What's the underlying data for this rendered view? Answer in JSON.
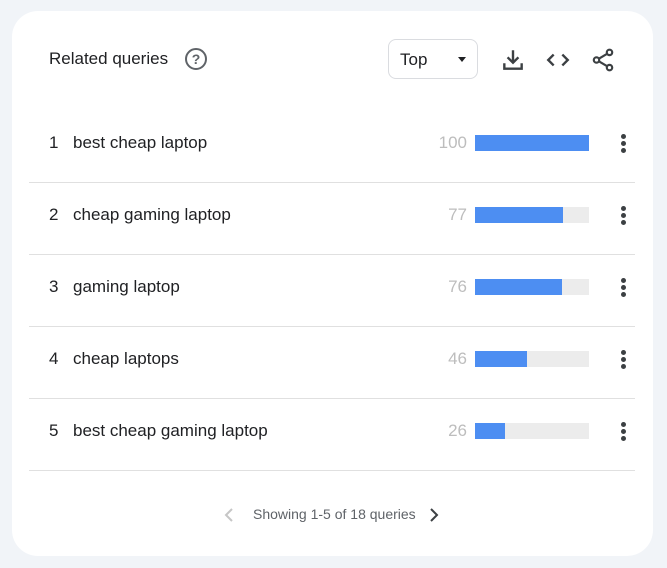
{
  "header": {
    "title": "Related queries",
    "help_icon": "?",
    "select": {
      "selected": "Top"
    },
    "icons": [
      "download-icon",
      "embed-code-icon",
      "share-icon"
    ]
  },
  "rows": [
    {
      "rank": "1",
      "query": "best cheap laptop",
      "value": "100",
      "fill": 100
    },
    {
      "rank": "2",
      "query": "cheap gaming laptop",
      "value": "77",
      "fill": 77
    },
    {
      "rank": "3",
      "query": "gaming laptop",
      "value": "76",
      "fill": 76
    },
    {
      "rank": "4",
      "query": "cheap laptops",
      "value": "46",
      "fill": 46
    },
    {
      "rank": "5",
      "query": "best cheap gaming laptop",
      "value": "26",
      "fill": 26
    }
  ],
  "pagination": {
    "text": "Showing 1-5 of 18 queries"
  },
  "colors": {
    "bar": "#4d8ef2",
    "track": "#ececec",
    "value_text": "#bdbdbd"
  }
}
